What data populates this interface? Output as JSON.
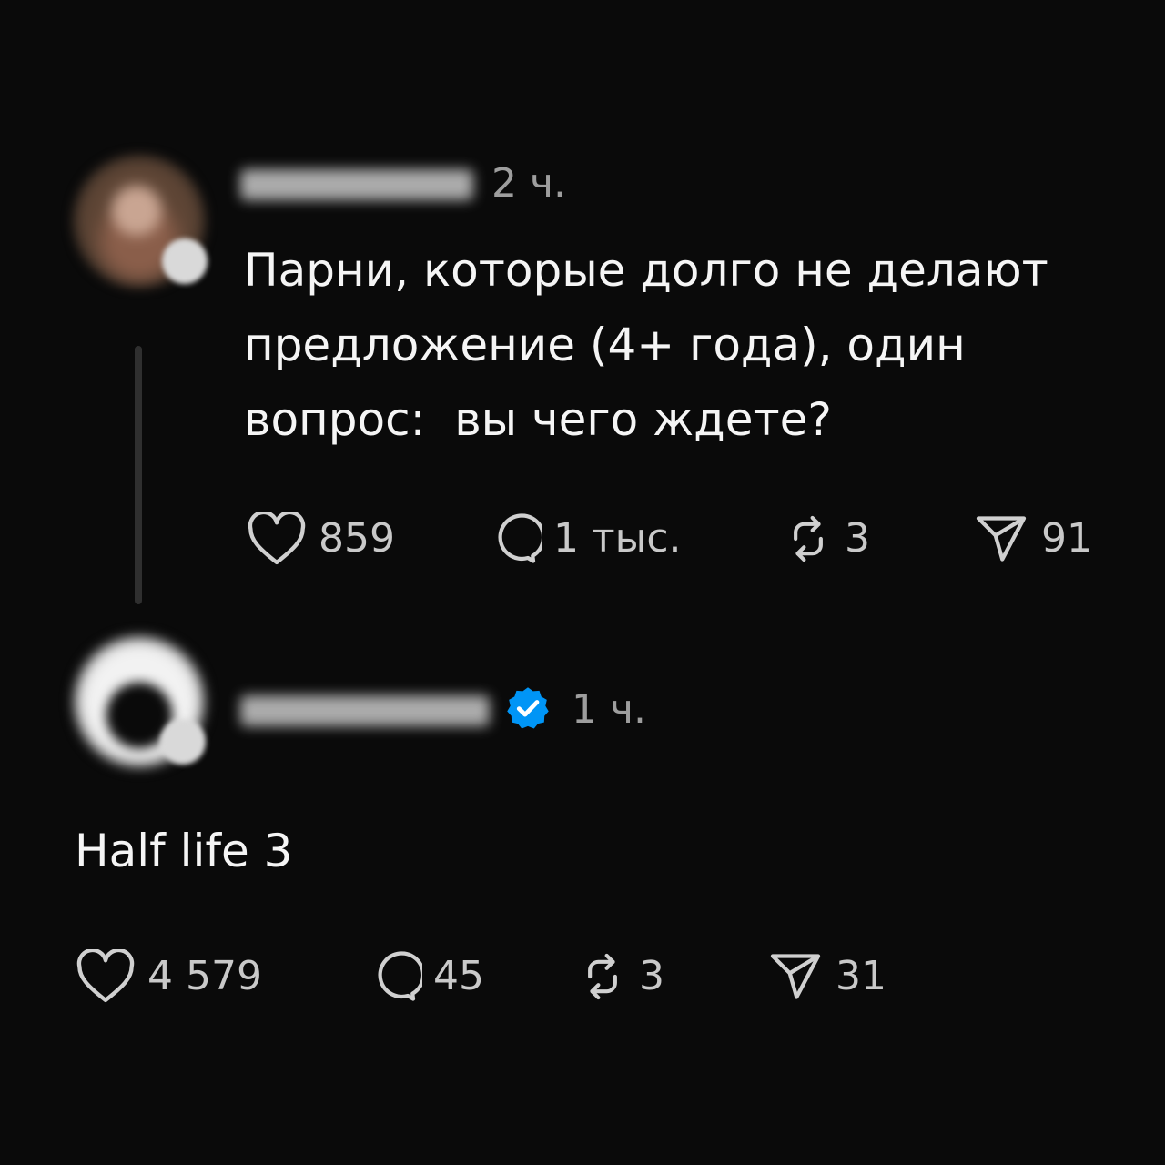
{
  "colors": {
    "background": "#0a0a0a",
    "text": "#f5f5f5",
    "muted": "#9e9e9e",
    "icon": "#d0d0d0",
    "verified_blue": "#0095f6"
  },
  "post": {
    "time": "2 ч.",
    "text": "Парни, которые долго не делают предложение (4+ года), один вопрос:  вы чего ждете?",
    "likes": "859",
    "comments": "1 тыс.",
    "reposts": "3",
    "shares": "91"
  },
  "reply": {
    "time": "1 ч.",
    "verified": true,
    "text": "Half life 3",
    "likes": "4 579",
    "comments": "45",
    "reposts": "3",
    "shares": "31"
  },
  "icons": {
    "like": "heart-icon",
    "comment": "speech-bubble-icon",
    "repost": "repost-arrows-icon",
    "share": "paper-plane-icon",
    "verified": "verified-badge-icon"
  }
}
